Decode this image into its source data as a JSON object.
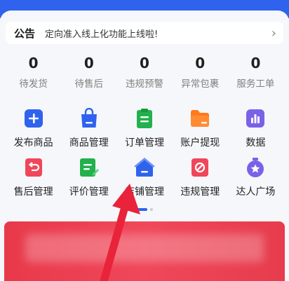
{
  "notice": {
    "tag": "公告",
    "text": "定向准入线上化功能上线啦!",
    "arrow": "›"
  },
  "stats": [
    {
      "value": "0",
      "label": "待发货"
    },
    {
      "value": "0",
      "label": "待售后"
    },
    {
      "value": "0",
      "label": "违规预警"
    },
    {
      "value": "0",
      "label": "异常包裹"
    },
    {
      "value": "0",
      "label": "服务工单"
    }
  ],
  "tools": [
    {
      "label": "发布商品",
      "icon": "plus-icon",
      "color": "#2f63ee"
    },
    {
      "label": "商品管理",
      "icon": "shopping-bag-icon",
      "color": "#2f63ee"
    },
    {
      "label": "订单管理",
      "icon": "clipboard-icon",
      "color": "#22b14c"
    },
    {
      "label": "账户提现",
      "icon": "folder-icon",
      "color": "#ff7a1a"
    },
    {
      "label": "数据",
      "icon": "bar-chart-icon",
      "color": "#7b61e8"
    },
    {
      "label": "售后管理",
      "icon": "return-icon",
      "color": "#f0465a"
    },
    {
      "label": "评价管理",
      "icon": "review-icon",
      "color": "#22b14c"
    },
    {
      "label": "店铺管理",
      "icon": "store-icon",
      "color": "#2f63ee"
    },
    {
      "label": "违规管理",
      "icon": "prohibited-icon",
      "color": "#f0465a"
    },
    {
      "label": "达人广场",
      "icon": "star-badge-icon",
      "color": "#7b61e8"
    }
  ],
  "colors": {
    "brand": "#2f63ee",
    "annotation_arrow": "#e8233a"
  }
}
